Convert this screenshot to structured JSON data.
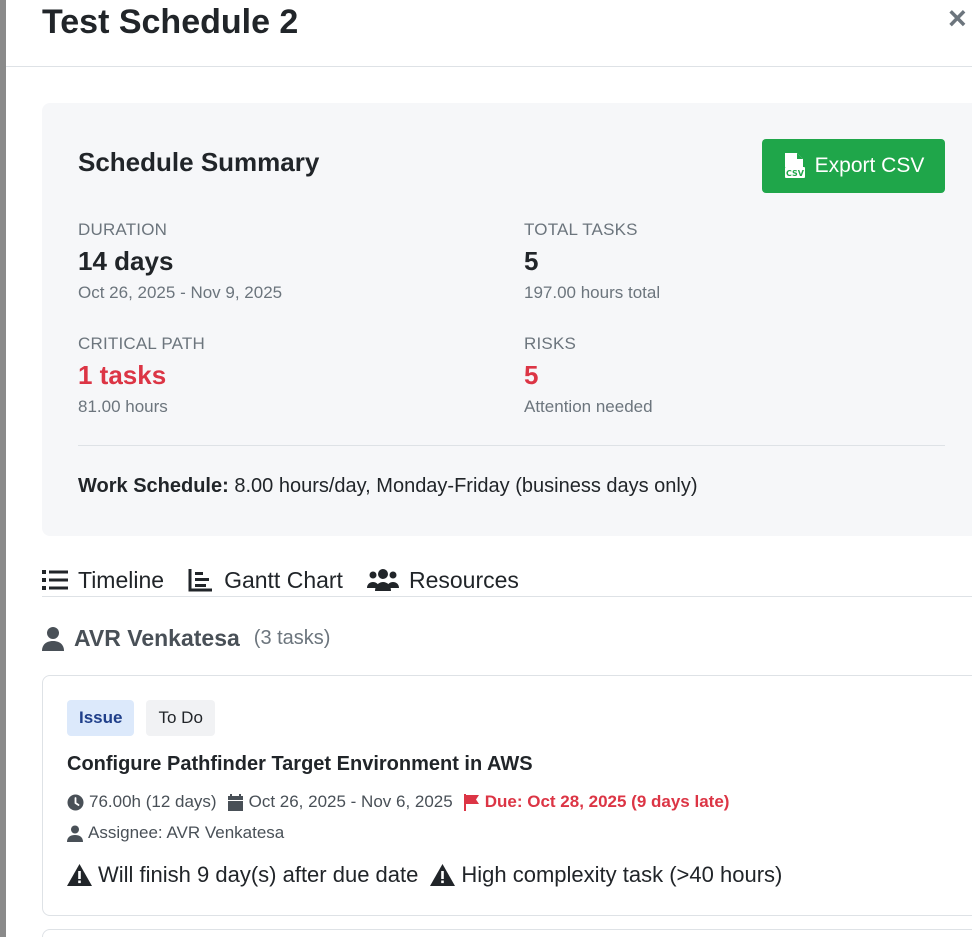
{
  "modal": {
    "title": "Test Schedule 2",
    "close_label": "×"
  },
  "summary": {
    "title": "Schedule Summary",
    "export_label": "Export CSV",
    "duration": {
      "label": "DURATION",
      "value": "14 days",
      "sub": "Oct 26, 2025 - Nov 9, 2025"
    },
    "total_tasks": {
      "label": "TOTAL TASKS",
      "value": "5",
      "sub": "197.00 hours total"
    },
    "critical_path": {
      "label": "CRITICAL PATH",
      "value": "1 tasks",
      "sub": "81.00 hours"
    },
    "risks": {
      "label": "RISKS",
      "value": "5",
      "sub": "Attention needed"
    },
    "work_schedule_label": "Work Schedule:",
    "work_schedule_value": " 8.00 hours/day, Monday-Friday (business days only)"
  },
  "tabs": [
    {
      "label": "Timeline",
      "icon": "list-icon"
    },
    {
      "label": "Gantt Chart",
      "icon": "chart-bar-icon"
    },
    {
      "label": "Resources",
      "icon": "users-icon"
    }
  ],
  "resource": {
    "name": "AVR Venkatesa",
    "count": "(3 tasks)"
  },
  "task": {
    "type_badge": "Issue",
    "status_badge": "To Do",
    "title": "Configure Pathfinder Target Environment in AWS",
    "effort": "76.00h (12 days)",
    "dates": "Oct 26, 2025 - Nov 6, 2025",
    "due": "Due: Oct 28, 2025 (9 days late)",
    "assignee": "Assignee: AVR Venkatesa",
    "warnings": [
      "Will finish 9 day(s) after due date",
      "High complexity task (>40 hours)"
    ]
  },
  "colors": {
    "accent_green": "#1fa64a",
    "danger": "#dc3545",
    "badge_issue_bg": "#dce9fb"
  }
}
